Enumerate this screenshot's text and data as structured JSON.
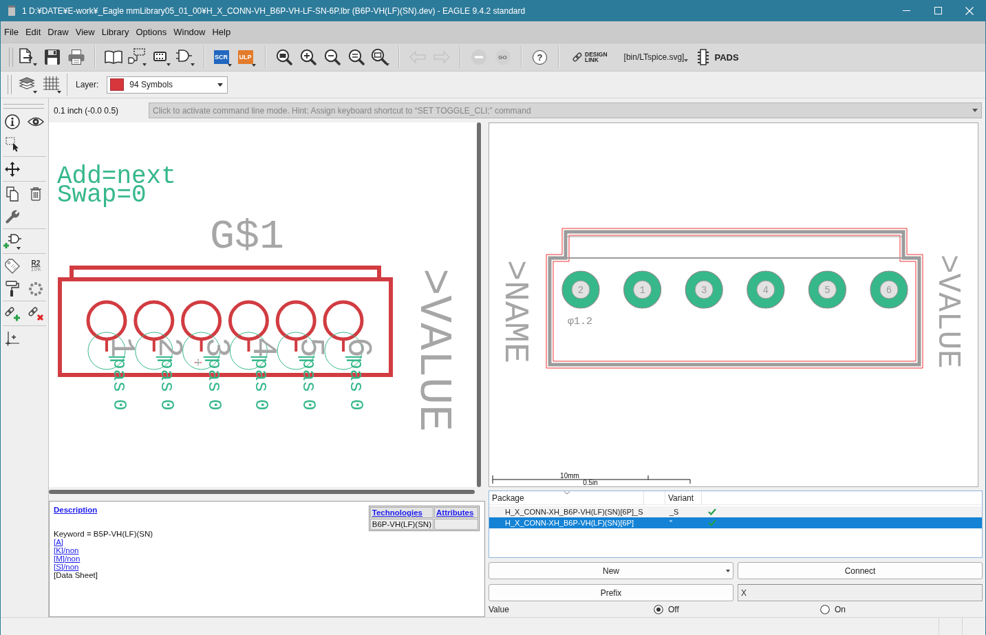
{
  "window": {
    "title": "1 D:¥DATE¥E-work¥_Eagle mmLibrary05_01_00¥H_X_CONN-VH_B6P-VH-LF-SN-6P.lbr (B6P-VH(LF)(SN).dev) - EAGLE 9.4.2 standard"
  },
  "menu": [
    "File",
    "Edit",
    "Draw",
    "View",
    "Library",
    "Options",
    "Window",
    "Help"
  ],
  "toolbar": {
    "script_button": {
      "label": "SCR"
    },
    "ulp_button": {
      "label": "ULP"
    },
    "undo_button": {
      "disabled": true
    },
    "redo_button": {
      "disabled": true
    },
    "stop_button": {
      "disabled": true
    },
    "go_button": {
      "label": "GO",
      "disabled": true
    },
    "help_button": {
      "label": "?"
    },
    "design_link": {
      "label": "DESIGN LINK"
    },
    "path_button": {
      "label": "[bin/LTspice.svg]"
    },
    "pads_button": {
      "label": "PADS"
    }
  },
  "layer_bar": {
    "label": "Layer:",
    "layer": "94 Symbols"
  },
  "left_toolbar": {
    "value_tool": {
      "name": "R2",
      "value": "10k"
    }
  },
  "coordinates": "0.1 inch (-0.0 0.5)",
  "command_line": {
    "placeholder": "Click to activate command line mode. Hint: Assign keyboard shortcut to “SET TOGGLE_CLI;” command"
  },
  "symbol_view": {
    "info_lines": [
      "Add=next",
      "Swap=0"
    ],
    "name": "G$1",
    "value": ">VALUE",
    "pins": [
      {
        "number": "1",
        "direction": "pas",
        "swap": "0"
      },
      {
        "number": "2",
        "direction": "pas",
        "swap": "0"
      },
      {
        "number": "3",
        "direction": "pas",
        "swap": "0"
      },
      {
        "number": "4",
        "direction": "pas",
        "swap": "0"
      },
      {
        "number": "5",
        "direction": "pas",
        "swap": "0"
      },
      {
        "number": "6",
        "direction": "pas",
        "swap": "0"
      }
    ]
  },
  "package_view": {
    "name": ">NAME",
    "value": ">VALUE",
    "pads": [
      "2",
      "1",
      "3",
      "4",
      "5",
      "6"
    ],
    "drill_label": "φ1.2",
    "scale": {
      "metric": "10mm",
      "imperial": "0.5in"
    }
  },
  "package_table": {
    "columns": [
      "Package",
      "Variant"
    ],
    "rows": [
      {
        "package": "H_X_CONN-XH_B6P-VH(LF)(SN)[6P]_S",
        "variant": "_S",
        "connected": true,
        "selected": false
      },
      {
        "package": "H_X_CONN-XH_B6P-VH(LF)(SN)[6P]",
        "variant": "''",
        "connected": true,
        "selected": true
      }
    ]
  },
  "buttons": {
    "new": "New",
    "connect": "Connect",
    "prefix": "Prefix"
  },
  "prefix_field": {
    "value": "X"
  },
  "value_option": {
    "label": "Value",
    "options": [
      {
        "label": "Off",
        "selected": true
      },
      {
        "label": "On",
        "selected": false
      }
    ]
  },
  "description": {
    "heading": "Description",
    "keyword": "Keyword = B5P-VH(LF)(SN)",
    "lines": [
      {
        "kind": "link",
        "text": "[A]"
      },
      {
        "kind": "link",
        "text": "[K]/non"
      },
      {
        "kind": "link",
        "text": "[M]/non"
      },
      {
        "kind": "link",
        "text": "[S]/non"
      },
      {
        "kind": "text",
        "text": "[Data Sheet]"
      }
    ]
  },
  "technologies": {
    "columns": [
      "Technologies",
      "Attributes"
    ],
    "rows": [
      {
        "technology": "B6P-VH(LF)(SN)"
      }
    ]
  }
}
